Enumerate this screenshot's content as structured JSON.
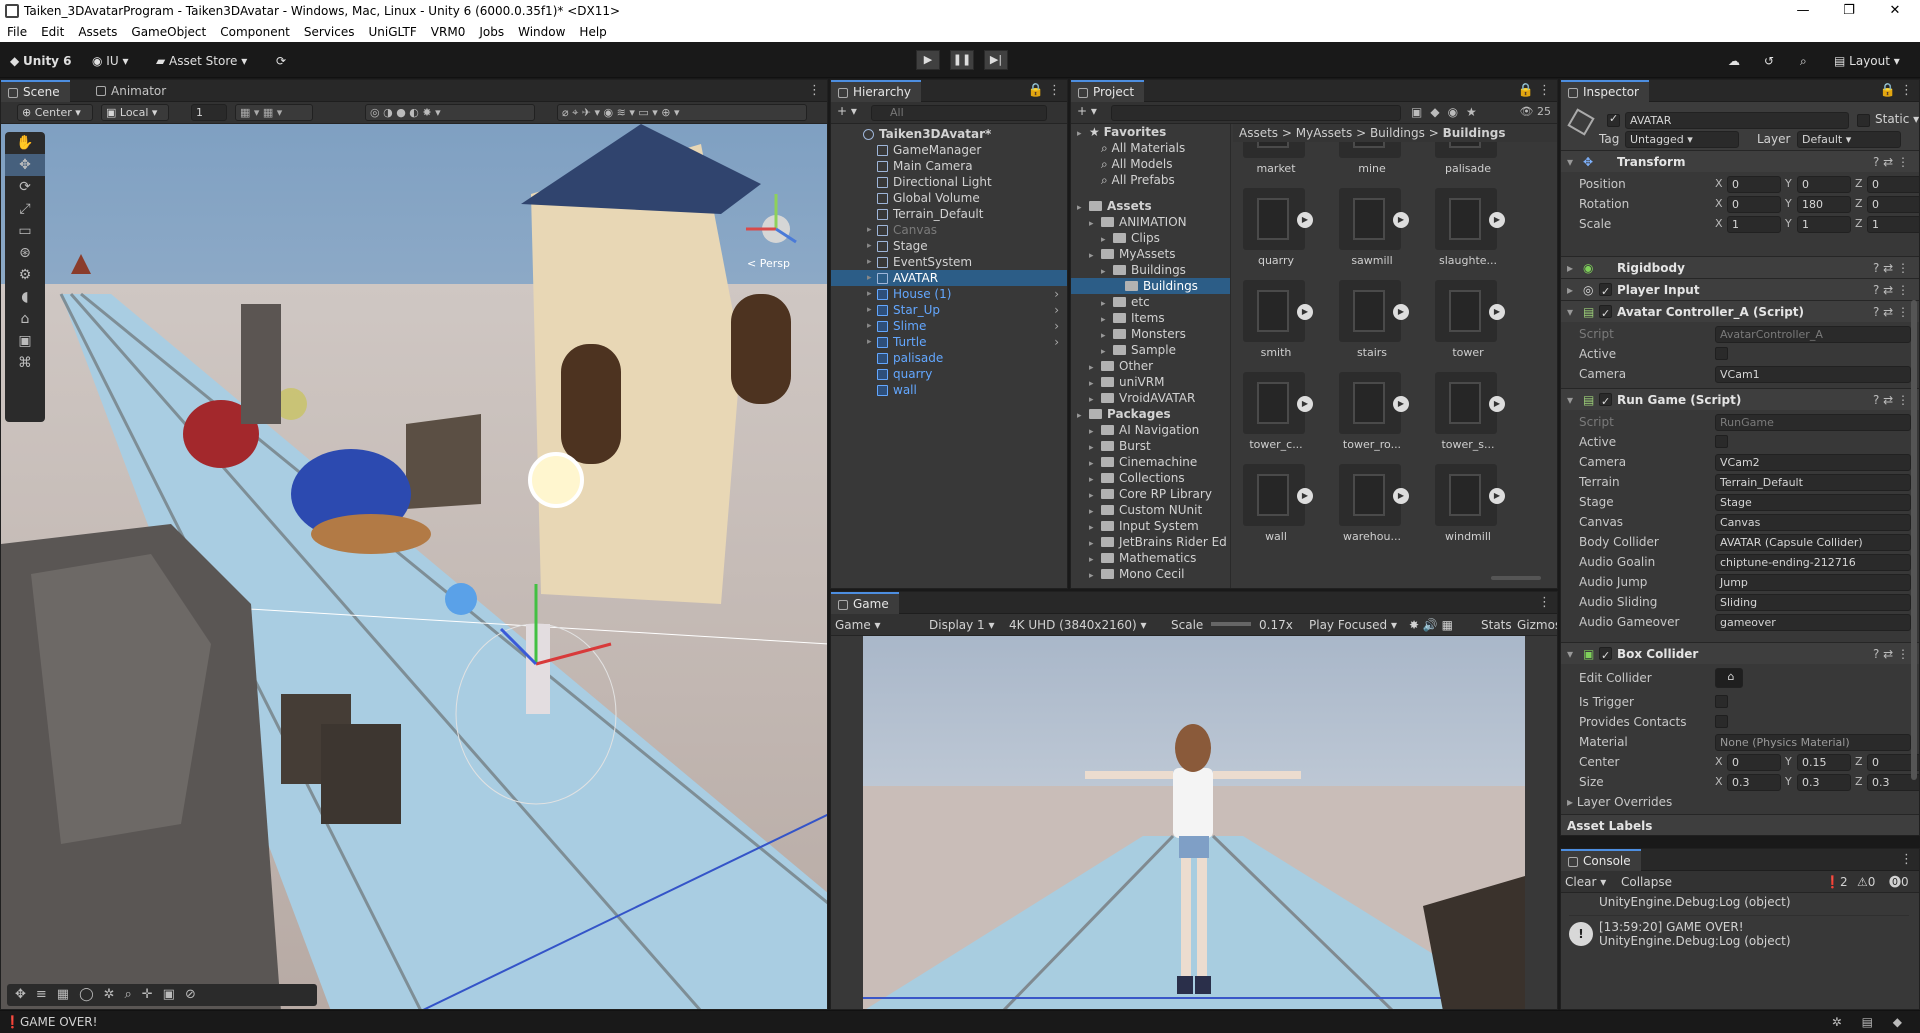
{
  "window": {
    "title": "Taiken_3DAvatarProgram - Taiken3DAvatar - Windows, Mac, Linux - Unity 6 (6000.0.35f1)* <DX11>",
    "controls": [
      "—",
      "❐",
      "✕"
    ]
  },
  "menu": [
    "File",
    "Edit",
    "Assets",
    "GameObject",
    "Component",
    "Services",
    "UniGLTF",
    "VRM0",
    "Jobs",
    "Window",
    "Help"
  ],
  "toolbar": {
    "unity_label": "Unity 6",
    "account": "IU",
    "asset_store": "Asset Store",
    "layout": "Layout"
  },
  "scene": {
    "tabs": [
      "Scene",
      "Animator"
    ],
    "pivot": "Center",
    "space": "Local",
    "snap_value": "1",
    "persp_label": "< Persp"
  },
  "hierarchy": {
    "tab": "Hierarchy",
    "search_placeholder": "All",
    "root": "Taiken3DAvatar*",
    "items": [
      {
        "label": "GameManager",
        "type": "obj"
      },
      {
        "label": "Main Camera",
        "type": "obj"
      },
      {
        "label": "Directional Light",
        "type": "obj"
      },
      {
        "label": "Global Volume",
        "type": "obj"
      },
      {
        "label": "Terrain_Default",
        "type": "obj"
      },
      {
        "label": "Canvas",
        "type": "dim"
      },
      {
        "label": "Stage",
        "type": "obj"
      },
      {
        "label": "EventSystem",
        "type": "obj"
      },
      {
        "label": "AVATAR",
        "type": "sel"
      },
      {
        "label": "House (1)",
        "type": "prefab"
      },
      {
        "label": "Star_Up",
        "type": "prefab"
      },
      {
        "label": "Slime",
        "type": "prefab"
      },
      {
        "label": "Turtle",
        "type": "prefab"
      },
      {
        "label": "palisade",
        "type": "prefab"
      },
      {
        "label": "quarry",
        "type": "prefab"
      },
      {
        "label": "wall",
        "type": "prefab"
      }
    ]
  },
  "project": {
    "tab": "Project",
    "count": "25",
    "breadcrumb": [
      "Assets",
      "MyAssets",
      "Buildings",
      "Buildings"
    ],
    "tree": [
      {
        "label": "Favorites",
        "level": 0,
        "bold": true,
        "kind": "star"
      },
      {
        "label": "All Materials",
        "level": 1,
        "kind": "search"
      },
      {
        "label": "All Models",
        "level": 1,
        "kind": "search"
      },
      {
        "label": "All Prefabs",
        "level": 1,
        "kind": "search"
      },
      {
        "label": "",
        "level": 0,
        "kind": "gap"
      },
      {
        "label": "Assets",
        "level": 0,
        "bold": true,
        "kind": "folder"
      },
      {
        "label": "ANIMATION",
        "level": 1,
        "kind": "folder"
      },
      {
        "label": "Clips",
        "level": 2,
        "kind": "folder"
      },
      {
        "label": "MyAssets",
        "level": 1,
        "kind": "folder"
      },
      {
        "label": "Buildings",
        "level": 2,
        "kind": "folder"
      },
      {
        "label": "Buildings",
        "level": 3,
        "kind": "folder",
        "sel": true
      },
      {
        "label": "etc",
        "level": 2,
        "kind": "folder"
      },
      {
        "label": "Items",
        "level": 2,
        "kind": "folder"
      },
      {
        "label": "Monsters",
        "level": 2,
        "kind": "folder"
      },
      {
        "label": "Sample",
        "level": 2,
        "kind": "folder"
      },
      {
        "label": "Other",
        "level": 1,
        "kind": "folder"
      },
      {
        "label": "uniVRM",
        "level": 1,
        "kind": "folder"
      },
      {
        "label": "VroidAVATAR",
        "level": 1,
        "kind": "folder"
      },
      {
        "label": "Packages",
        "level": 0,
        "bold": true,
        "kind": "folder"
      },
      {
        "label": "AI Navigation",
        "level": 1,
        "kind": "folder"
      },
      {
        "label": "Burst",
        "level": 1,
        "kind": "folder"
      },
      {
        "label": "Cinemachine",
        "level": 1,
        "kind": "folder"
      },
      {
        "label": "Collections",
        "level": 1,
        "kind": "folder"
      },
      {
        "label": "Core RP Library",
        "level": 1,
        "kind": "folder"
      },
      {
        "label": "Custom NUnit",
        "level": 1,
        "kind": "folder"
      },
      {
        "label": "Input System",
        "level": 1,
        "kind": "folder"
      },
      {
        "label": "JetBrains Rider Ed",
        "level": 1,
        "kind": "folder"
      },
      {
        "label": "Mathematics",
        "level": 1,
        "kind": "folder"
      },
      {
        "label": "Mono Cecil",
        "level": 1,
        "kind": "folder"
      }
    ],
    "assets": [
      "market",
      "mine",
      "palisade",
      "quarry",
      "sawmill",
      "slaughte...",
      "smith",
      "stairs",
      "tower",
      "tower_c...",
      "tower_ro...",
      "tower_s...",
      "wall",
      "warehou...",
      "windmill"
    ]
  },
  "game": {
    "tab": "Game",
    "mode": "Game",
    "display": "Display 1",
    "resolution": "4K UHD (3840x2160)",
    "scale_label": "Scale",
    "scale_value": "0.17x",
    "play_mode": "Play Focused",
    "stats": "Stats",
    "gizmos": "Gizmos"
  },
  "inspector": {
    "tab": "Inspector",
    "object_name": "AVATAR",
    "static_label": "Static",
    "tag_label": "Tag",
    "tag": "Untagged",
    "layer_label": "Layer",
    "layer": "Default",
    "transform": {
      "title": "Transform",
      "position": {
        "label": "Position",
        "x": "0",
        "y": "0",
        "z": "0"
      },
      "rotation": {
        "label": "Rotation",
        "x": "0",
        "y": "180",
        "z": "0"
      },
      "scale": {
        "label": "Scale",
        "x": "1",
        "y": "1",
        "z": "1"
      }
    },
    "rigidbody": "Rigidbody",
    "player_input": "Player Input",
    "avatar_controller": {
      "title": "Avatar Controller_A (Script)",
      "script_label": "Script",
      "script": "AvatarController_A",
      "active_label": "Active",
      "camera_label": "Camera",
      "camera": "VCam1"
    },
    "run_game": {
      "title": "Run Game (Script)",
      "fields": [
        {
          "label": "Script",
          "value": "RunGame",
          "dim": true
        },
        {
          "label": "Active",
          "value": "",
          "check": true
        },
        {
          "label": "Camera",
          "value": "VCam2"
        },
        {
          "label": "Terrain",
          "value": "Terrain_Default"
        },
        {
          "label": "Stage",
          "value": "Stage"
        },
        {
          "label": "Canvas",
          "value": "Canvas"
        },
        {
          "label": "Body Collider",
          "value": "AVATAR (Capsule Collider)"
        },
        {
          "label": "Audio Goalin",
          "value": "chiptune-ending-212716"
        },
        {
          "label": "Audio Jump",
          "value": "Jump"
        },
        {
          "label": "Audio Sliding",
          "value": "Sliding"
        },
        {
          "label": "Audio Gameover",
          "value": "gameover"
        }
      ]
    },
    "box_collider": {
      "title": "Box Collider",
      "edit_label": "Edit Collider",
      "trigger_label": "Is Trigger",
      "contacts_label": "Provides Contacts",
      "material_label": "Material",
      "material": "None (Physics Material)",
      "center": {
        "label": "Center",
        "x": "0",
        "y": "0.15",
        "z": "0"
      },
      "size": {
        "label": "Size",
        "x": "0.3",
        "y": "0.3",
        "z": "0.3"
      },
      "layer_overrides": "Layer Overrides"
    },
    "asset_labels": "Asset Labels"
  },
  "console": {
    "tab": "Console",
    "clear": "Clear",
    "collapse": "Collapse",
    "counts": {
      "log": "2",
      "warn": "0",
      "error": "0"
    },
    "lines": [
      {
        "text": "UnityEngine.Debug:Log (object)",
        "sub": ""
      },
      {
        "text": "[13:59:20] GAME OVER!",
        "sub": "UnityEngine.Debug:Log (object)"
      }
    ]
  },
  "status": "GAME OVER!",
  "colors": {
    "accent": "#4d8ee0",
    "selection": "#2c5d87",
    "prefab": "#63a7ff",
    "panel": "#383838"
  }
}
